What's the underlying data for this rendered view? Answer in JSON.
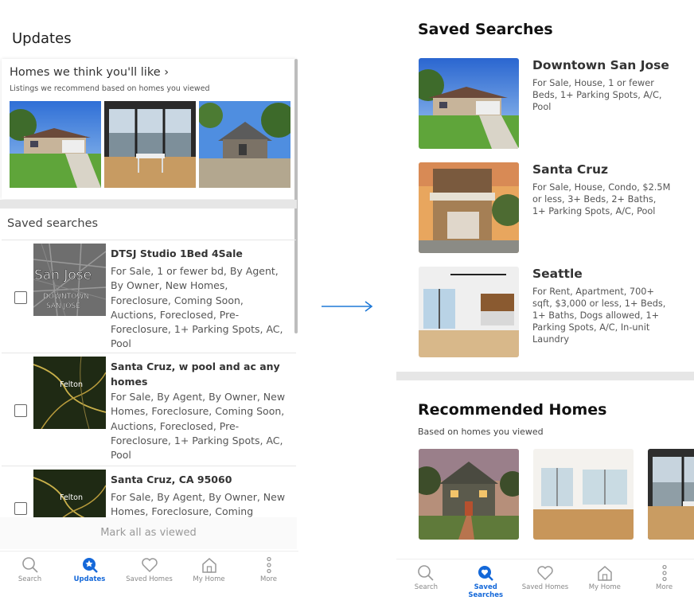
{
  "left": {
    "title": "Updates",
    "homes_card": {
      "title": "Homes we think you'll like",
      "chevron": "›",
      "subtitle": "Listings we recommend based on homes you viewed"
    },
    "saved_label": "Saved searches",
    "saved_searches": [
      {
        "name": "DTSJ Studio 1Bed 4Sale",
        "desc": "For Sale, 1 or fewer bd, By Agent, By Owner, New Homes, Foreclosure, Coming Soon, Auctions, Foreclosed, Pre-Foreclosure, 1+ Parking Spots, AC, Pool",
        "map_text_1": "San Jose",
        "map_text_2": "DOWNTOWN SAN JOSE"
      },
      {
        "name": "Santa Cruz, w pool and ac any homes",
        "desc": "For Sale, By Agent, By Owner, New Homes, Foreclosure, Coming Soon, Auctions, Foreclosed, Pre-Foreclosure, 1+ Parking Spots, AC, Pool",
        "map_text_1": "Felton"
      },
      {
        "name": "Santa Cruz, CA 95060",
        "desc": "For Sale, By Agent, By Owner, New Homes, Foreclosure, Coming",
        "map_text_1": "Felton"
      }
    ],
    "mark_all": "Mark all as viewed",
    "nav": [
      {
        "label": "Search",
        "icon": "search-icon"
      },
      {
        "label": "Updates",
        "icon": "updates-icon",
        "active": true
      },
      {
        "label": "Saved Homes",
        "icon": "heart-icon"
      },
      {
        "label": "My Home",
        "icon": "home-icon"
      },
      {
        "label": "More",
        "icon": "more-icon"
      }
    ]
  },
  "right": {
    "title": "Saved Searches",
    "items": [
      {
        "name": "Downtown San Jose",
        "desc": "For Sale, House, 1 or fewer Beds, 1+ Parking Spots, A/C, Pool"
      },
      {
        "name": "Santa Cruz",
        "desc": "For Sale, House, Condo, $2.5M or less, 3+ Beds, 2+ Baths, 1+ Parking Spots, A/C, Pool"
      },
      {
        "name": "Seattle",
        "desc": "For Rent, Apartment, 700+ sqft, $3,000 or less, 1+ Beds, 1+ Baths, Dogs allowed, 1+ Parking Spots, A/C, In-unit Laundry"
      }
    ],
    "recommended_title": "Recommended Homes",
    "recommended_sub": "Based on homes you viewed",
    "nav": [
      {
        "label": "Search",
        "icon": "search-icon"
      },
      {
        "label": "Saved Searches",
        "icon": "saved-searches-icon",
        "active": true
      },
      {
        "label": "Saved Homes",
        "icon": "heart-icon"
      },
      {
        "label": "My Home",
        "icon": "home-icon"
      },
      {
        "label": "More",
        "icon": "more-icon"
      }
    ]
  },
  "colors": {
    "accent": "#1468d9",
    "arrow": "#1e78d7"
  }
}
